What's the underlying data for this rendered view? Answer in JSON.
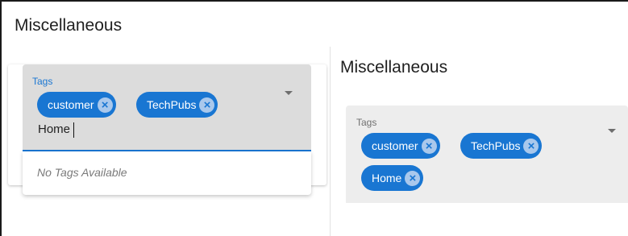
{
  "left_panel": {
    "title": "Miscellaneous",
    "tags_field": {
      "label": "Tags",
      "chips": [
        {
          "label": "customer"
        },
        {
          "label": "TechPubs"
        }
      ],
      "input_value": "Home",
      "remove_icon": "close-circle-icon",
      "dropdown_icon": "arrow-drop-down-icon"
    },
    "dropdown_menu": {
      "empty_message": "No Tags Available"
    }
  },
  "right_panel": {
    "title": "Miscellaneous",
    "tags_field": {
      "label": "Tags",
      "chips": [
        {
          "label": "customer"
        },
        {
          "label": "TechPubs"
        },
        {
          "label": "Home"
        }
      ],
      "remove_icon": "close-circle-icon",
      "dropdown_icon": "arrow-drop-down-icon"
    }
  },
  "colors": {
    "accent": "#1976d2",
    "chip_remove_bg": "#a9c8ec",
    "field_active_bg": "#dcdcdc",
    "field_idle_bg": "#ededed"
  }
}
